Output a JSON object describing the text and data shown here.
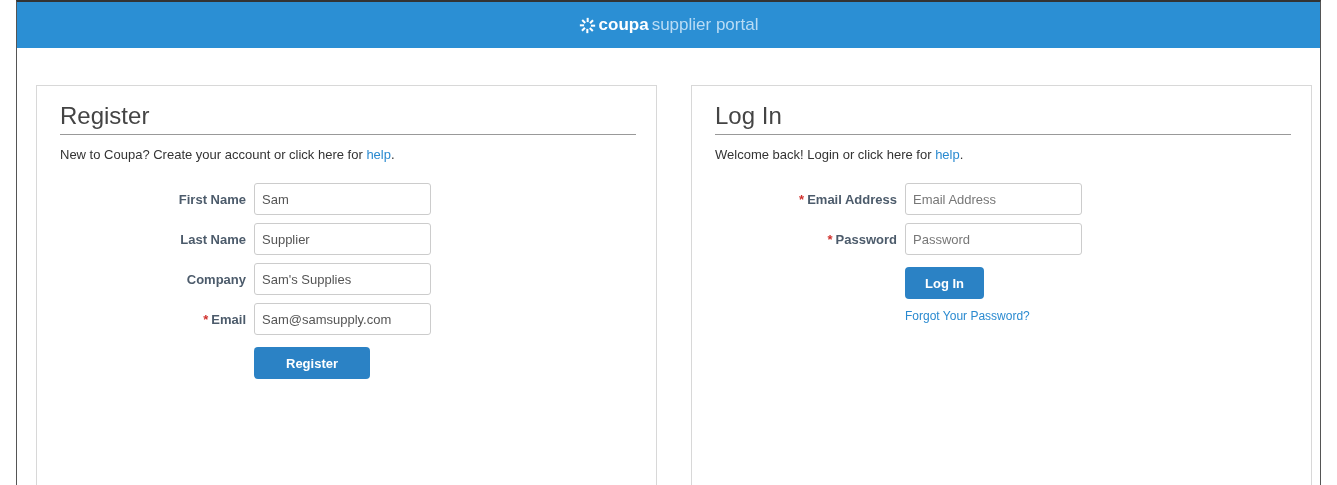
{
  "header": {
    "brand": "coupa",
    "product": "supplier portal"
  },
  "register": {
    "title": "Register",
    "intro": "New to Coupa? Create your account or click here for ",
    "link": "help",
    "end": ".",
    "fields": [
      {
        "label": "First Name",
        "required": false,
        "value": "Sam"
      },
      {
        "label": "Last Name",
        "required": false,
        "value": "Supplier"
      },
      {
        "label": "Company",
        "required": false,
        "value": "Sam's Supplies"
      },
      {
        "label": "Email",
        "required": true,
        "required_mark": "*",
        "value": "Sam@samsupply.com"
      }
    ],
    "button": "Register"
  },
  "login": {
    "title": "Log In",
    "intro": "Welcome back! Login or click here for ",
    "link": "help",
    "end": ".",
    "fields": [
      {
        "label": "Email Address",
        "required": true,
        "required_mark": "*",
        "placeholder": "Email Address"
      },
      {
        "label": "Password",
        "required": true,
        "required_mark": "*",
        "placeholder": "Password"
      }
    ],
    "button": "Log In",
    "forgot": "Forgot Your Password?"
  }
}
